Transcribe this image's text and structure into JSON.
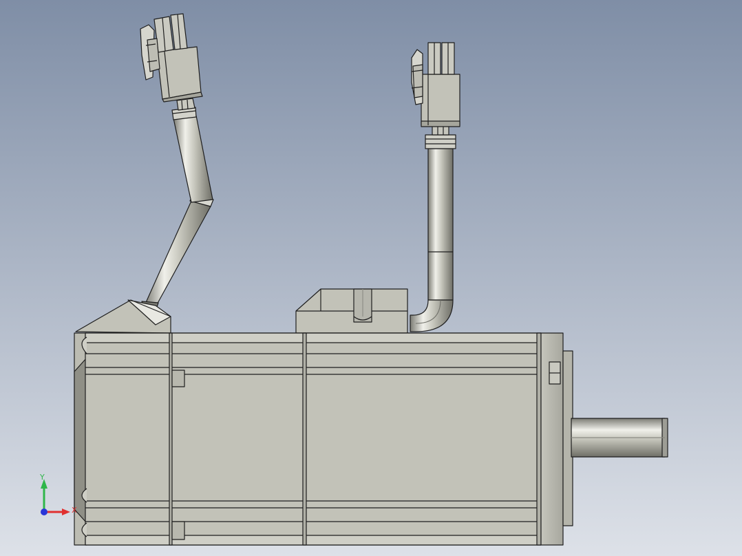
{
  "viewport": {
    "background_top": "#7f8ea6",
    "background_bottom": "#dde1e8"
  },
  "model": {
    "body_color": "#c2c2b8",
    "body_shade": "#a9a99f",
    "edge_color": "#1e1e1e",
    "highlight": "#eeeeea"
  },
  "triad": {
    "x_label": "X",
    "y_label": "Y",
    "x_color": "#e03030",
    "y_color": "#2fb64a",
    "z_color": "#2a36d8"
  }
}
